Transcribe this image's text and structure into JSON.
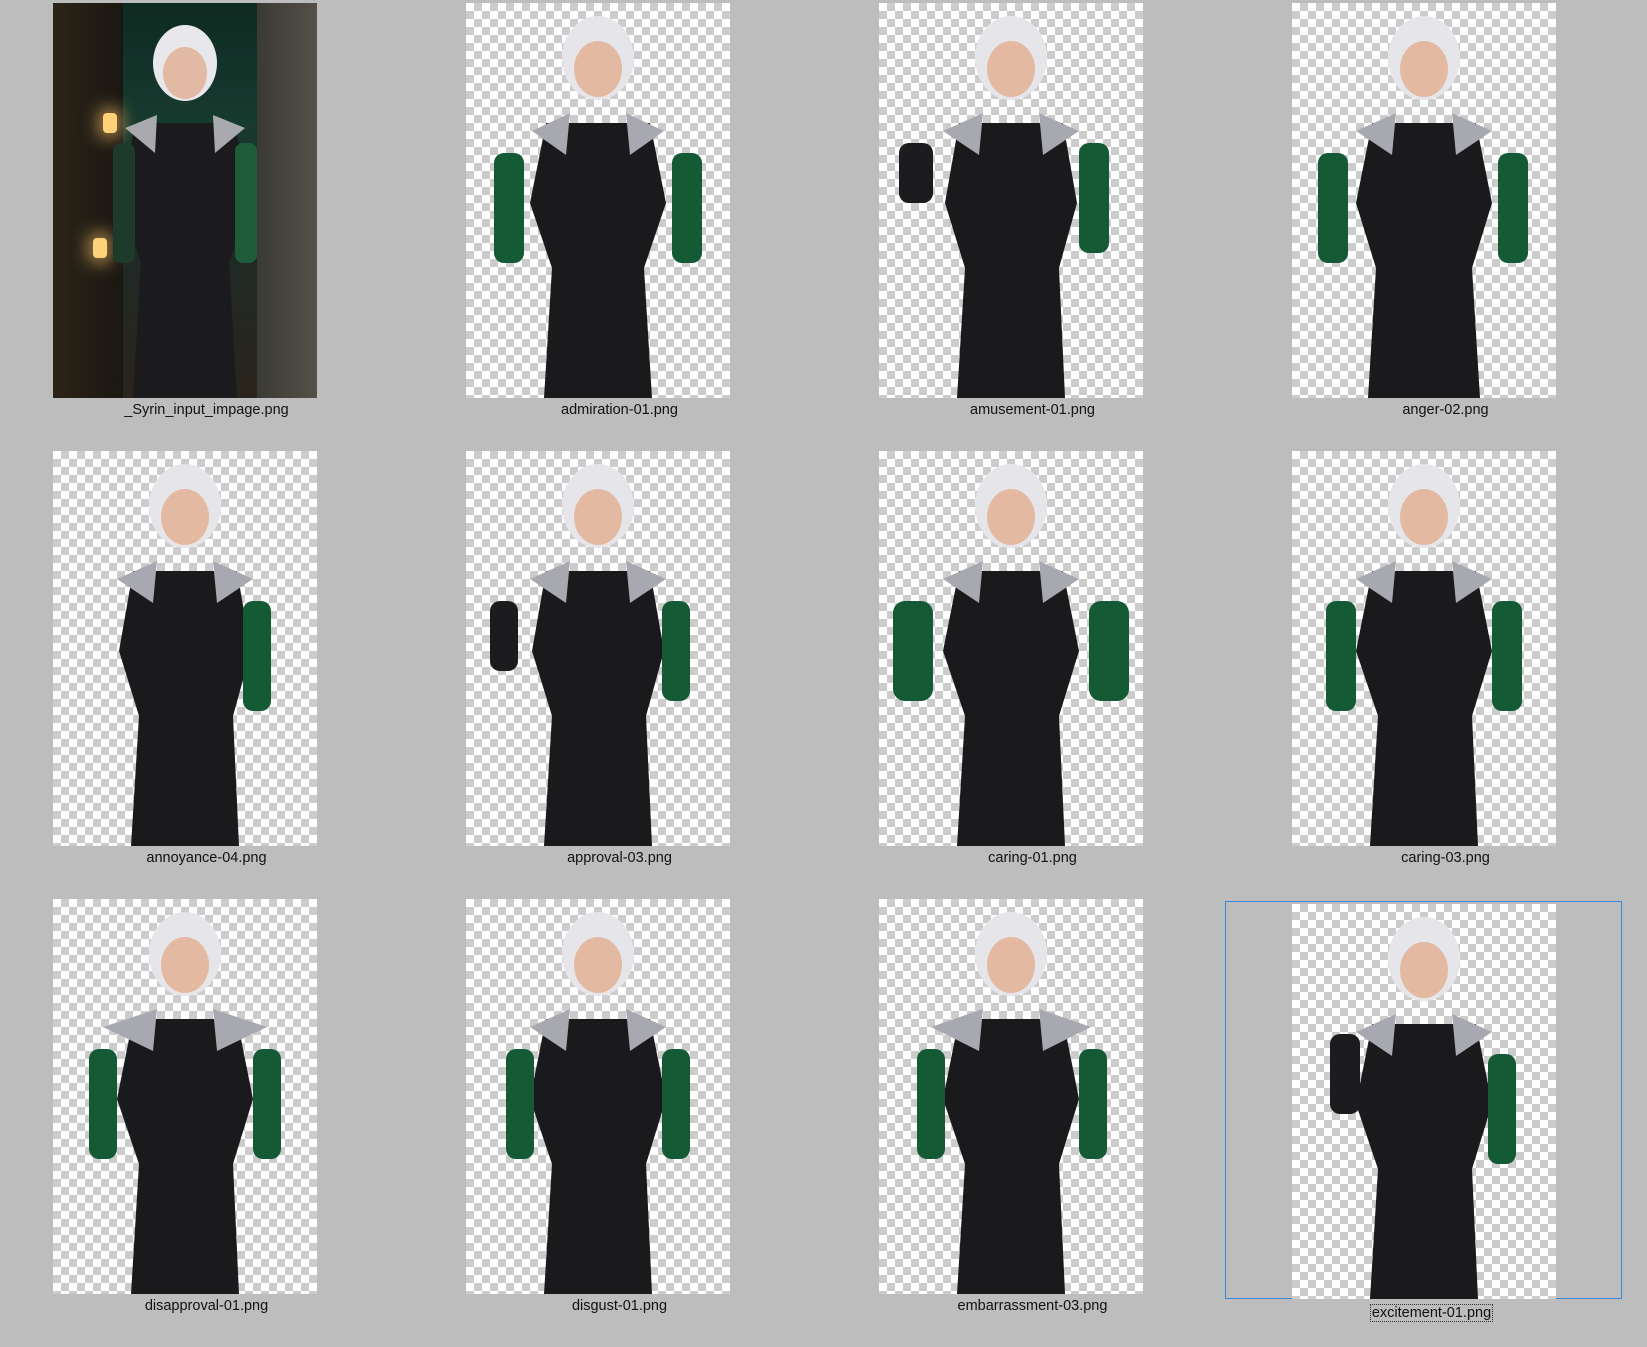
{
  "window": {},
  "colors": {
    "background": "#bdbdbd",
    "checker_light": "#ffffff",
    "checker_dark": "#cccccc",
    "selection_border": "#3b8ad9",
    "caption_text": "#111111"
  },
  "files": [
    {
      "name": "_Syrin_input_impage.png",
      "kind": "photo",
      "selected": false
    },
    {
      "name": "admiration-01.png",
      "kind": "transparent",
      "selected": false
    },
    {
      "name": "amusement-01.png",
      "kind": "transparent",
      "selected": false
    },
    {
      "name": "anger-02.png",
      "kind": "transparent",
      "selected": false
    },
    {
      "name": "annoyance-04.png",
      "kind": "transparent",
      "selected": false
    },
    {
      "name": "approval-03.png",
      "kind": "transparent",
      "selected": false
    },
    {
      "name": "caring-01.png",
      "kind": "transparent",
      "selected": false
    },
    {
      "name": "caring-03.png",
      "kind": "transparent",
      "selected": false
    },
    {
      "name": "disapproval-01.png",
      "kind": "transparent",
      "selected": false
    },
    {
      "name": "disgust-01.png",
      "kind": "transparent",
      "selected": false
    },
    {
      "name": "embarrassment-03.png",
      "kind": "transparent",
      "selected": false
    },
    {
      "name": "excitement-01.png",
      "kind": "transparent",
      "selected": true
    }
  ],
  "icons": {
    "thumbnail": "character-portrait-icon",
    "transparency": "checkerboard-transparency-icon"
  }
}
